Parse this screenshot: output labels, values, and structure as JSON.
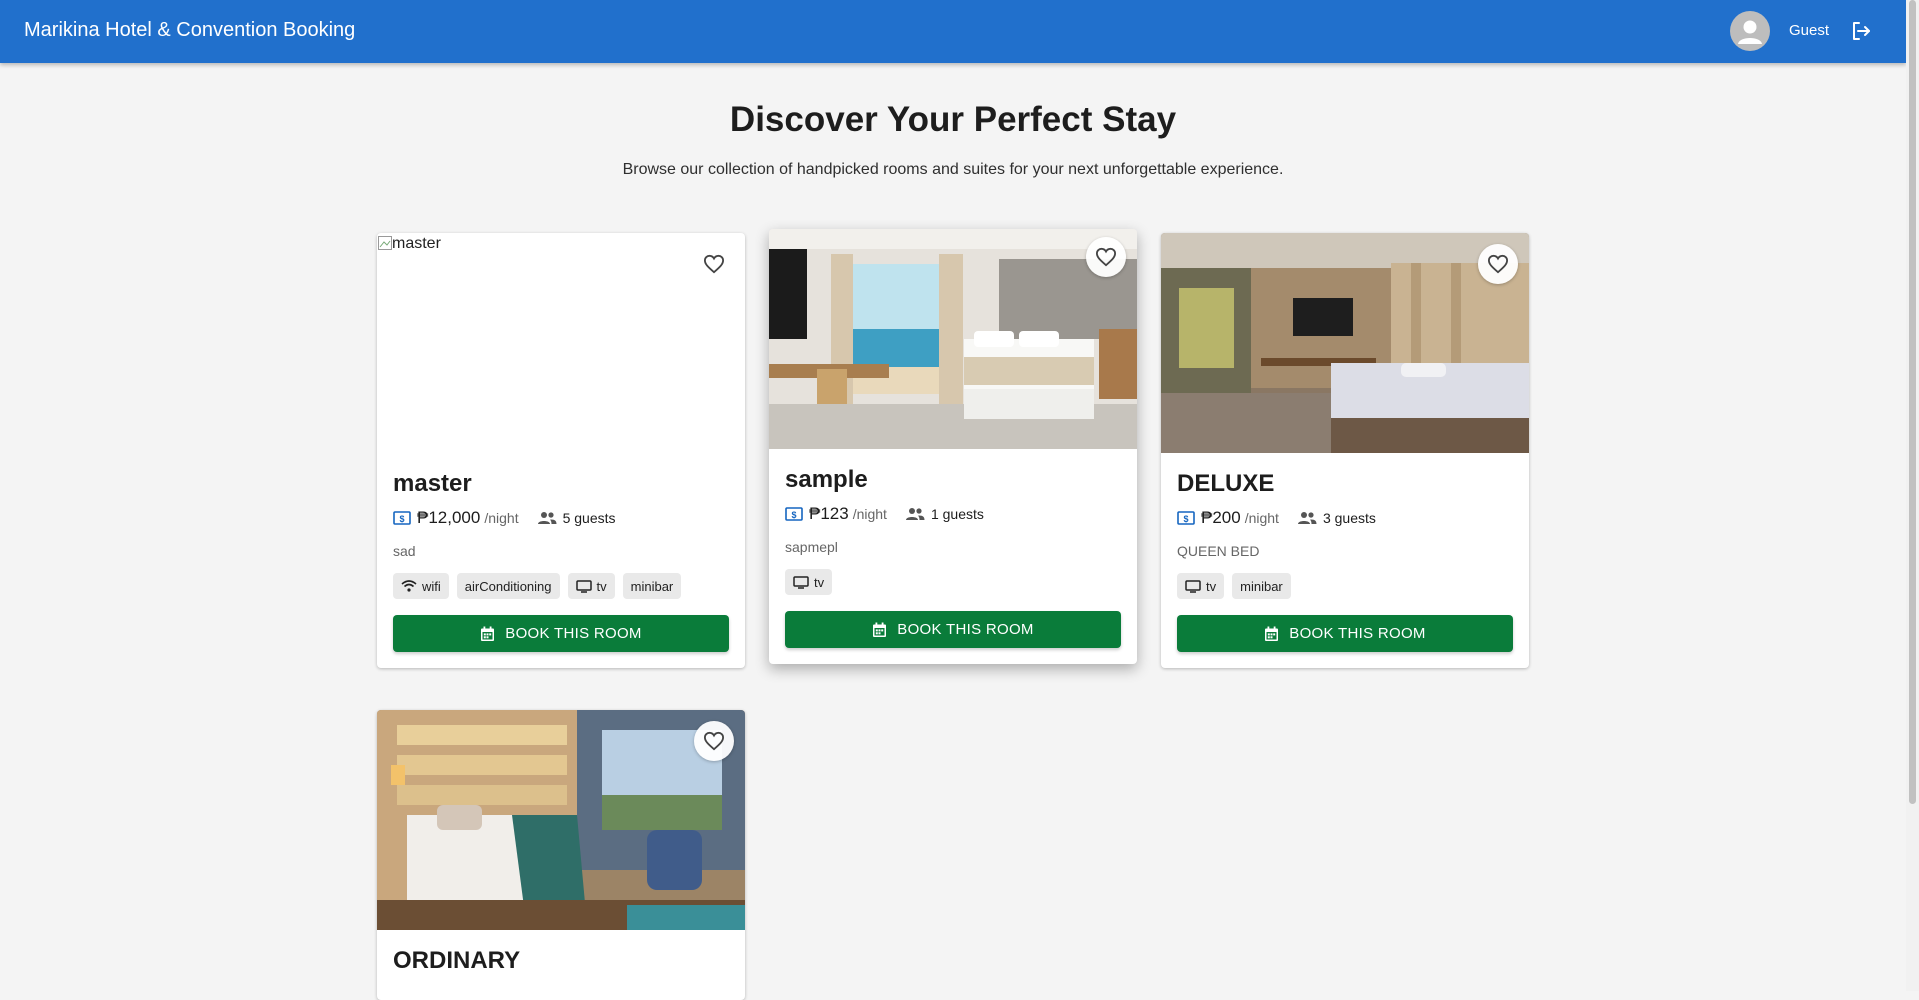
{
  "app": {
    "title": "Marikina Hotel & Convention Booking",
    "user": "Guest"
  },
  "hero": {
    "title": "Discover Your Perfect Stay",
    "subtitle": "Browse our collection of handpicked rooms and suites for your next unforgettable experience."
  },
  "rooms": [
    {
      "name": "master",
      "image_alt": "master",
      "price": "₱12,000",
      "per_night": "/night",
      "guests": "5 guests",
      "description": "sad",
      "amenities": [
        "wifi",
        "airConditioning",
        "tv",
        "minibar"
      ],
      "book_label": "BOOK THIS ROOM"
    },
    {
      "name": "sample",
      "price": "₱123",
      "per_night": "/night",
      "guests": "1 guests",
      "description": "sapmepl",
      "amenities": [
        "tv"
      ],
      "book_label": "BOOK THIS ROOM"
    },
    {
      "name": "DELUXE",
      "price": "₱200",
      "per_night": "/night",
      "guests": "3 guests",
      "description": "QUEEN BED",
      "amenities": [
        "tv",
        "minibar"
      ],
      "book_label": "BOOK THIS ROOM"
    },
    {
      "name": "ORDINARY"
    }
  ],
  "icons": {
    "avatar": "account-circle-icon",
    "logout": "logout-icon",
    "favorite": "heart-outline-icon",
    "price": "money-icon",
    "guests": "people-icon",
    "wifi": "wifi-icon",
    "tv": "tv-icon",
    "book": "calendar-icon"
  },
  "colors": {
    "appbar": "#2170cc",
    "book_button": "#0a7c3a",
    "background": "#f4f4f4",
    "price_icon": "#1565c0"
  }
}
